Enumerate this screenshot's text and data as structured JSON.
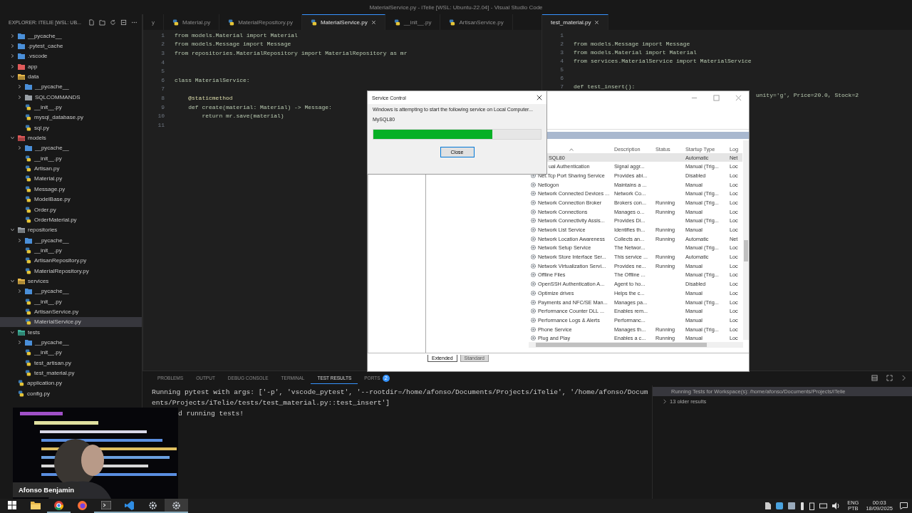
{
  "window": {
    "title": "MaterialService.py - iTelie [WSL: Ubuntu-22.04] - Visual Studio Code"
  },
  "explorer": {
    "title": "EXPLORER: ITELIE [WSL: UB...",
    "items": [
      {
        "label": "__pycache__",
        "kind": "folder",
        "color": "#4a8fd8",
        "expanded": false,
        "selected": false
      },
      {
        "label": ".pytest_cache",
        "kind": "folder",
        "color": "#4a8fd8",
        "expanded": false,
        "selected": false
      },
      {
        "label": ".vscode",
        "kind": "folder",
        "color": "#4a8fd8",
        "expanded": false,
        "selected": false
      },
      {
        "label": "app",
        "kind": "folder",
        "color": "#e05a5a",
        "expanded": false,
        "selected": false
      },
      {
        "label": "data",
        "kind": "folder",
        "color": "#e8b84a",
        "expanded": true,
        "selected": false,
        "children": [
          {
            "label": "__pycache__",
            "kind": "folder",
            "color": "#4a8fd8",
            "expanded": false,
            "selected": false
          },
          {
            "label": "SQLCOMMANDS",
            "kind": "folder",
            "color": "#9aa0a6",
            "expanded": false,
            "selected": false
          },
          {
            "label": "__init__.py",
            "kind": "file",
            "selected": false
          },
          {
            "label": "mysql_database.py",
            "kind": "file",
            "selected": false
          },
          {
            "label": "sql.py",
            "kind": "file",
            "selected": false
          }
        ]
      },
      {
        "label": "models",
        "kind": "folder",
        "color": "#e05a5a",
        "expanded": true,
        "selected": false,
        "children": [
          {
            "label": "__pycache__",
            "kind": "folder",
            "color": "#4a8fd8",
            "expanded": false,
            "selected": false
          },
          {
            "label": "__init__.py",
            "kind": "file",
            "selected": false
          },
          {
            "label": "Artisan.py",
            "kind": "file",
            "selected": false
          },
          {
            "label": "Material.py",
            "kind": "file",
            "selected": false
          },
          {
            "label": "Message.py",
            "kind": "file",
            "selected": false
          },
          {
            "label": "ModelBase.py",
            "kind": "file",
            "selected": false
          },
          {
            "label": "Order.py",
            "kind": "file",
            "selected": false
          },
          {
            "label": "OrderMaterial.py",
            "kind": "file",
            "selected": false
          }
        ]
      },
      {
        "label": "repositories",
        "kind": "folder",
        "color": "#9aa0a6",
        "expanded": true,
        "selected": false,
        "children": [
          {
            "label": "__pycache__",
            "kind": "folder",
            "color": "#4a8fd8",
            "expanded": false,
            "selected": false
          },
          {
            "label": "__init__.py",
            "kind": "file",
            "selected": false
          },
          {
            "label": "ArtisanRepository.py",
            "kind": "file",
            "selected": false
          },
          {
            "label": "MaterialRepository.py",
            "kind": "file",
            "selected": false
          }
        ]
      },
      {
        "label": "services",
        "kind": "folder",
        "color": "#e8b84a",
        "expanded": true,
        "selected": false,
        "children": [
          {
            "label": "__pycache__",
            "kind": "folder",
            "color": "#4a8fd8",
            "expanded": false,
            "selected": false
          },
          {
            "label": "__init__.py",
            "kind": "file",
            "selected": false
          },
          {
            "label": "ArtisanService.py",
            "kind": "file",
            "selected": false
          },
          {
            "label": "MaterialService.py",
            "kind": "file",
            "selected": true
          }
        ]
      },
      {
        "label": "tests",
        "kind": "folder",
        "color": "#3fb39b",
        "expanded": true,
        "selected": false,
        "children": [
          {
            "label": "__pycache__",
            "kind": "folder",
            "color": "#4a8fd8",
            "expanded": false,
            "selected": false
          },
          {
            "label": "__init__.py",
            "kind": "file",
            "selected": false
          },
          {
            "label": "test_artisan.py",
            "kind": "file",
            "selected": false
          },
          {
            "label": "test_material.py",
            "kind": "file",
            "selected": false
          }
        ]
      },
      {
        "label": "application.py",
        "kind": "file",
        "selected": false
      },
      {
        "label": "config.py",
        "kind": "file",
        "selected": false
      }
    ]
  },
  "editor_groups": [
    {
      "tabs": [
        {
          "label": "y",
          "kind": "cut",
          "selected": false
        },
        {
          "label": "Material.py",
          "kind": "file",
          "selected": false
        },
        {
          "label": "MaterialRepository.py",
          "kind": "file",
          "selected": false
        },
        {
          "label": "MaterialService.py",
          "kind": "file",
          "selected": true
        },
        {
          "label": "__init__.py",
          "kind": "file",
          "selected": false
        },
        {
          "label": "ArtisanService.py",
          "kind": "file",
          "selected": false
        }
      ],
      "lines": [
        {
          "number": "1",
          "text": "from models.Material import Material",
          "kind": "code"
        },
        {
          "number": "2",
          "text": "from models.Message import Message",
          "kind": "code"
        },
        {
          "number": "3",
          "text": "from repositories.MaterialRepository import MaterialRepository as mr",
          "kind": "code"
        },
        {
          "number": "4",
          "kind": "code"
        },
        {
          "number": "5",
          "kind": "code"
        },
        {
          "number": "6",
          "text": "class MaterialService:",
          "kind": "code"
        },
        {
          "number": "7",
          "kind": "code"
        },
        {
          "number": "8",
          "text": "    @staticmethod",
          "kind": "code"
        },
        {
          "number": "9",
          "text": "    def create(material: Material) -> Message:",
          "kind": "code"
        },
        {
          "number": "10",
          "text": "        return mr.save(material)",
          "kind": "code"
        },
        {
          "number": "11",
          "kind": "code"
        }
      ]
    },
    {
      "tabs": [
        {
          "label": "test_material.py",
          "kind": "cut",
          "selected": true
        }
      ],
      "lines": [
        {
          "number": "1",
          "kind": "code"
        },
        {
          "number": "2",
          "text": "from models.Message import Message",
          "kind": "code"
        },
        {
          "number": "3",
          "text": "from models.Material import Material",
          "kind": "code"
        },
        {
          "number": "4",
          "text": "from services.MaterialService import MaterialService",
          "kind": "code"
        },
        {
          "number": "5",
          "kind": "code"
        },
        {
          "number": "6",
          "kind": "code"
        },
        {
          "number": "7",
          "text": "def test_insert():",
          "kind": "code"
        },
        {
          "text": "unity='g', Price=20.0, Stock=2",
          "kind": "tail"
        }
      ]
    }
  ],
  "panel": {
    "tabs": [
      {
        "label": "PROBLEMS",
        "selected": false
      },
      {
        "label": "OUTPUT",
        "selected": false
      },
      {
        "label": "DEBUG CONSOLE",
        "selected": false
      },
      {
        "label": "TERMINAL",
        "selected": false
      },
      {
        "label": "TEST RESULTS",
        "selected": true
      },
      {
        "label": "PORTS",
        "selected": false,
        "badge": "2"
      }
    ],
    "output": [
      {
        "text": "Running pytest with args: ['-p', 'vscode_pytest', '--rootdir=/home/afonso/Documents/Projects/iTelie', '/home/afonso/Documents/Projects/iTelie/tests/test_material.py::test_insert']",
        "kind": "full"
      },
      {
        "text": "d running tests!",
        "kind": "tail"
      }
    ],
    "results_header": "Running Tests for Workspace(s): /home/afonso/Documents/Projects/iTelie",
    "results": [
      {
        "label": "13 older results",
        "expanded": false
      }
    ]
  },
  "services_window": {
    "columns": [
      "Description",
      "Status",
      "Startup Type",
      "Log"
    ],
    "rows": [
      {
        "name": "SQL80",
        "startup": "Automatic",
        "log": "Net",
        "kind": "cut",
        "selected": true
      },
      {
        "name": "ual Authentication",
        "description": "Signal aggr...",
        "startup": "Manual (Trig...",
        "log": "Loc",
        "kind": "cut",
        "selected": false
      },
      {
        "name": "Net.Tcp Port Sharing Service",
        "description": "Provides abi...",
        "startup": "Disabled",
        "log": "Loc",
        "kind": "full",
        "selected": false
      },
      {
        "name": "Netlogon",
        "description": "Maintains a ...",
        "startup": "Manual",
        "log": "Loc",
        "kind": "full",
        "selected": false
      },
      {
        "name": "Network Connected Devices ...",
        "description": "Network Co...",
        "startup": "Manual (Trig...",
        "log": "Loc",
        "kind": "full",
        "selected": false
      },
      {
        "name": "Network Connection Broker",
        "description": "Brokers con...",
        "status": "Running",
        "startup": "Manual (Trig...",
        "log": "Loc",
        "kind": "full",
        "selected": false
      },
      {
        "name": "Network Connections",
        "description": "Manages o...",
        "status": "Running",
        "startup": "Manual",
        "log": "Loc",
        "kind": "full",
        "selected": false
      },
      {
        "name": "Network Connectivity Assis...",
        "description": "Provides Di...",
        "startup": "Manual (Trig...",
        "log": "Loc",
        "kind": "full",
        "selected": false
      },
      {
        "name": "Network List Service",
        "description": "Identifies th...",
        "status": "Running",
        "startup": "Manual",
        "log": "Loc",
        "kind": "full",
        "selected": false
      },
      {
        "name": "Network Location Awareness",
        "description": "Collects an...",
        "status": "Running",
        "startup": "Automatic",
        "log": "Net",
        "kind": "full",
        "selected": false
      },
      {
        "name": "Network Setup Service",
        "description": "The Networ...",
        "startup": "Manual (Trig...",
        "log": "Loc",
        "kind": "full",
        "selected": false
      },
      {
        "name": "Network Store Interface Ser...",
        "description": "This service ...",
        "status": "Running",
        "startup": "Automatic",
        "log": "Loc",
        "kind": "full",
        "selected": false
      },
      {
        "name": "Network Virtualization Servi...",
        "description": "Provides ne...",
        "status": "Running",
        "startup": "Manual",
        "log": "Loc",
        "kind": "full",
        "selected": false
      },
      {
        "name": "Offline Files",
        "description": "The Offline ...",
        "startup": "Manual (Trig...",
        "log": "Loc",
        "kind": "full",
        "selected": false
      },
      {
        "name": "OpenSSH Authentication A...",
        "description": "Agent to ho...",
        "startup": "Disabled",
        "log": "Loc",
        "kind": "full",
        "selected": false
      },
      {
        "name": "Optimize drives",
        "description": "Helps the c...",
        "startup": "Manual",
        "log": "Loc",
        "kind": "full",
        "selected": false
      },
      {
        "name": "Payments and NFC/SE Man...",
        "description": "Manages pa...",
        "startup": "Manual (Trig...",
        "log": "Loc",
        "kind": "full",
        "selected": false
      },
      {
        "name": "Performance Counter DLL ...",
        "description": "Enables rem...",
        "startup": "Manual",
        "log": "Loc",
        "kind": "full",
        "selected": false
      },
      {
        "name": "Performance Logs & Alerts",
        "description": "Performanc...",
        "startup": "Manual",
        "log": "Loc",
        "kind": "full",
        "selected": false
      },
      {
        "name": "Phone Service",
        "description": "Manages th...",
        "status": "Running",
        "startup": "Manual (Trig...",
        "log": "Loc",
        "kind": "full",
        "selected": false
      },
      {
        "name": "Plug and Play",
        "description": "Enables a c...",
        "status": "Running",
        "startup": "Manual",
        "log": "Loc",
        "kind": "full",
        "selected": false
      }
    ],
    "view_tabs": [
      {
        "label": "Extended",
        "selected": true
      },
      {
        "label": "Standard",
        "selected": false
      }
    ]
  },
  "dialog": {
    "title": "Service Control",
    "message": "Windows is attempting to start the following service on Local Computer...",
    "service": "MySQL80",
    "level": 0.71,
    "button": "Close"
  },
  "webcam": {
    "label": "Afonso Benjamin"
  },
  "taskbar": {
    "apps": [
      {
        "kind": "windows",
        "open": false,
        "selected": false
      },
      {
        "kind": "folder",
        "open": false,
        "selected": false
      },
      {
        "kind": "chrome",
        "open": true,
        "selected": false
      },
      {
        "kind": "firefox",
        "open": false,
        "selected": false
      },
      {
        "kind": "terminal",
        "open": true,
        "selected": false
      },
      {
        "kind": "vscode",
        "open": true,
        "selected": false
      },
      {
        "kind": "gear",
        "open": true,
        "selected": false
      },
      {
        "kind": "gear",
        "open": true,
        "selected": true
      }
    ],
    "language": [
      "ENG",
      "PTB"
    ],
    "time": "00:03",
    "date": "18/09/2025"
  }
}
